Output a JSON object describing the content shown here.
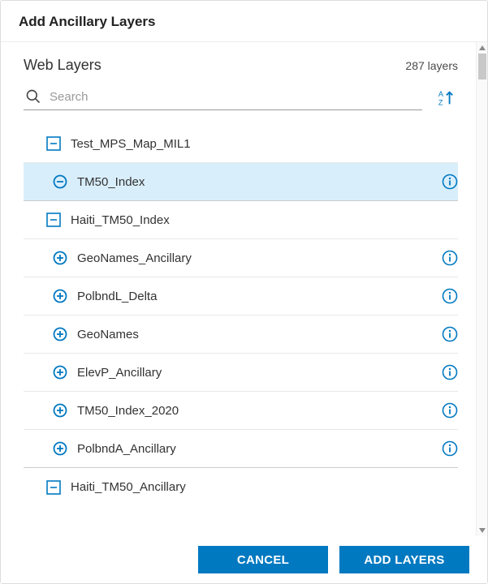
{
  "dialog": {
    "title": "Add Ancillary Layers"
  },
  "section": {
    "title": "Web Layers",
    "count_label": "287 layers"
  },
  "search": {
    "placeholder": "Search"
  },
  "groups": [
    {
      "label": "Test_MPS_Map_MIL1",
      "expanded": true,
      "children": [
        {
          "label": "TM50_Index",
          "selected": true
        }
      ]
    },
    {
      "label": "Haiti_TM50_Index",
      "expanded": true,
      "children": [
        {
          "label": "GeoNames_Ancillary"
        },
        {
          "label": "PolbndL_Delta"
        },
        {
          "label": "GeoNames"
        },
        {
          "label": "ElevP_Ancillary"
        },
        {
          "label": "TM50_Index_2020"
        },
        {
          "label": "PolbndA_Ancillary"
        }
      ]
    },
    {
      "label": "Haiti_TM50_Ancillary",
      "expanded": true,
      "children": []
    }
  ],
  "footer": {
    "cancel": "CANCEL",
    "add": "ADD LAYERS"
  },
  "colors": {
    "accent": "#0079c1",
    "selected_bg": "#d9eefb"
  }
}
